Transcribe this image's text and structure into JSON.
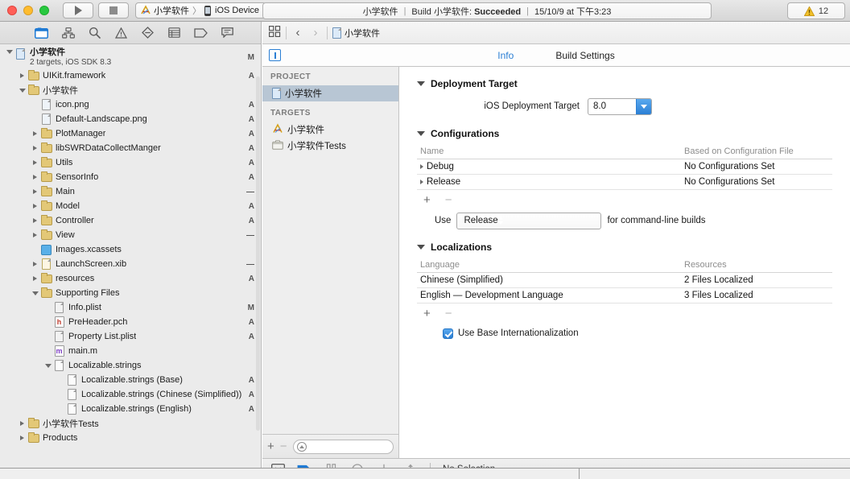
{
  "toolbar": {
    "run_label": "Run",
    "stop_label": "Stop",
    "scheme_name": "小学软件",
    "scheme_separator": "〉",
    "destination": "iOS Device",
    "activity": {
      "project": "小学软件",
      "sep1": "|",
      "build_prefix": "Build 小学软件:",
      "build_status": "Succeeded",
      "sep2": "|",
      "timestamp": "15/10/9 at 下午3:23"
    },
    "warning_count": "12"
  },
  "navigator": {
    "tabs": [
      {
        "name": "project-navigator",
        "selected": true
      },
      {
        "name": "symbol-navigator",
        "selected": false
      },
      {
        "name": "find-navigator",
        "selected": false
      },
      {
        "name": "issue-navigator",
        "selected": false
      },
      {
        "name": "test-navigator",
        "selected": false
      },
      {
        "name": "debug-navigator",
        "selected": false
      },
      {
        "name": "breakpoint-navigator",
        "selected": false
      },
      {
        "name": "report-navigator",
        "selected": false
      }
    ],
    "tree": [
      {
        "label": "小学软件",
        "sub": "2 targets, iOS SDK 8.3",
        "status": "M",
        "indent": 0,
        "twisty": "open",
        "icon": "project"
      },
      {
        "label": "UIKit.framework",
        "status": "A",
        "indent": 1,
        "twisty": "closed",
        "icon": "framework"
      },
      {
        "label": "小学软件",
        "status": "",
        "indent": 1,
        "twisty": "open",
        "icon": "folder"
      },
      {
        "label": "icon.png",
        "status": "A",
        "indent": 2,
        "twisty": "",
        "icon": "image"
      },
      {
        "label": "Default-Landscape.png",
        "status": "A",
        "indent": 2,
        "twisty": "",
        "icon": "image"
      },
      {
        "label": "PlotManager",
        "status": "A",
        "indent": 2,
        "twisty": "closed",
        "icon": "folder"
      },
      {
        "label": "libSWRDataCollectManger",
        "status": "A",
        "indent": 2,
        "twisty": "closed",
        "icon": "folder"
      },
      {
        "label": "Utils",
        "status": "A",
        "indent": 2,
        "twisty": "closed",
        "icon": "folder"
      },
      {
        "label": "SensorInfo",
        "status": "A",
        "indent": 2,
        "twisty": "closed",
        "icon": "folder"
      },
      {
        "label": "Main",
        "status": "—",
        "indent": 2,
        "twisty": "closed",
        "icon": "folder"
      },
      {
        "label": "Model",
        "status": "A",
        "indent": 2,
        "twisty": "closed",
        "icon": "folder"
      },
      {
        "label": "Controller",
        "status": "A",
        "indent": 2,
        "twisty": "closed",
        "icon": "folder"
      },
      {
        "label": "View",
        "status": "—",
        "indent": 2,
        "twisty": "closed",
        "icon": "folder"
      },
      {
        "label": "Images.xcassets",
        "status": "",
        "indent": 2,
        "twisty": "",
        "icon": "xcassets"
      },
      {
        "label": "LaunchScreen.xib",
        "status": "—",
        "indent": 2,
        "twisty": "closed",
        "icon": "xib"
      },
      {
        "label": "resources",
        "status": "A",
        "indent": 2,
        "twisty": "closed",
        "icon": "folder"
      },
      {
        "label": "Supporting Files",
        "status": "",
        "indent": 2,
        "twisty": "open",
        "icon": "folder"
      },
      {
        "label": "Info.plist",
        "status": "M",
        "indent": 3,
        "twisty": "",
        "icon": "plist"
      },
      {
        "label": "PreHeader.pch",
        "status": "A",
        "indent": 3,
        "twisty": "",
        "icon": "header-h"
      },
      {
        "label": "Property List.plist",
        "status": "A",
        "indent": 3,
        "twisty": "",
        "icon": "plist"
      },
      {
        "label": "main.m",
        "status": "",
        "indent": 3,
        "twisty": "",
        "icon": "source-m"
      },
      {
        "label": "Localizable.strings",
        "status": "",
        "indent": 3,
        "twisty": "open",
        "icon": "strings"
      },
      {
        "label": "Localizable.strings (Base)",
        "status": "A",
        "indent": 4,
        "twisty": "",
        "icon": "strings"
      },
      {
        "label": "Localizable.strings (Chinese (Simplified))",
        "status": "A",
        "indent": 4,
        "twisty": "",
        "icon": "strings"
      },
      {
        "label": "Localizable.strings (English)",
        "status": "A",
        "indent": 4,
        "twisty": "",
        "icon": "strings"
      },
      {
        "label": "小学软件Tests",
        "status": "",
        "indent": 1,
        "twisty": "closed",
        "icon": "folder"
      },
      {
        "label": "Products",
        "status": "",
        "indent": 1,
        "twisty": "closed",
        "icon": "folder"
      }
    ]
  },
  "jumpbar": {
    "related_items_icon": "related-items-icon",
    "back_label": "‹",
    "forward_label": "›",
    "document": "小学软件"
  },
  "editor_tabs": {
    "items": [
      {
        "label": "Info",
        "active": true
      },
      {
        "label": "Build Settings",
        "active": false
      }
    ]
  },
  "project_list": {
    "project_header": "PROJECT",
    "targets_header": "TARGETS",
    "project_items": [
      {
        "label": "小学软件",
        "selected": true,
        "icon": "xcode-project-icon"
      }
    ],
    "target_items": [
      {
        "label": "小学软件",
        "selected": false,
        "icon": "app-target-icon"
      },
      {
        "label": "小学软件Tests",
        "selected": false,
        "icon": "test-target-icon"
      }
    ],
    "add_label": "+",
    "remove_label": "−",
    "filter_placeholder": ""
  },
  "settings": {
    "deployment": {
      "title": "Deployment Target",
      "field_label": "iOS Deployment Target",
      "value": "8.0"
    },
    "configurations": {
      "title": "Configurations",
      "columns": [
        "Name",
        "Based on Configuration File"
      ],
      "rows": [
        {
          "name": "Debug",
          "based_on": "No Configurations Set"
        },
        {
          "name": "Release",
          "based_on": "No Configurations Set"
        }
      ],
      "add_label": "+",
      "remove_label": "−",
      "use_prefix": "Use",
      "use_value": "Release",
      "use_suffix": "for command-line builds"
    },
    "localizations": {
      "title": "Localizations",
      "columns": [
        "Language",
        "Resources"
      ],
      "rows": [
        {
          "language": "Chinese (Simplified)",
          "resources": "2 Files Localized"
        },
        {
          "language": "English — Development Language",
          "resources": "3 Files Localized"
        }
      ],
      "add_label": "+",
      "remove_label": "−",
      "checkbox_label": "Use Base Internationalization",
      "checkbox_checked": true
    }
  },
  "debug_bar": {
    "toggle_icon": "hide-debug-area-icon",
    "continue_icon": "continue-icon",
    "pause_icon": "pause-icon",
    "step_over_icon": "step-over-icon",
    "step_into_icon": "step-into-icon",
    "step_out_icon": "step-out-icon",
    "status": "No Selection"
  },
  "colors": {
    "accent": "#2b7fd4",
    "selection": "#b8c6d4",
    "warning": "#f0b90b",
    "folder": "#e3c877"
  }
}
